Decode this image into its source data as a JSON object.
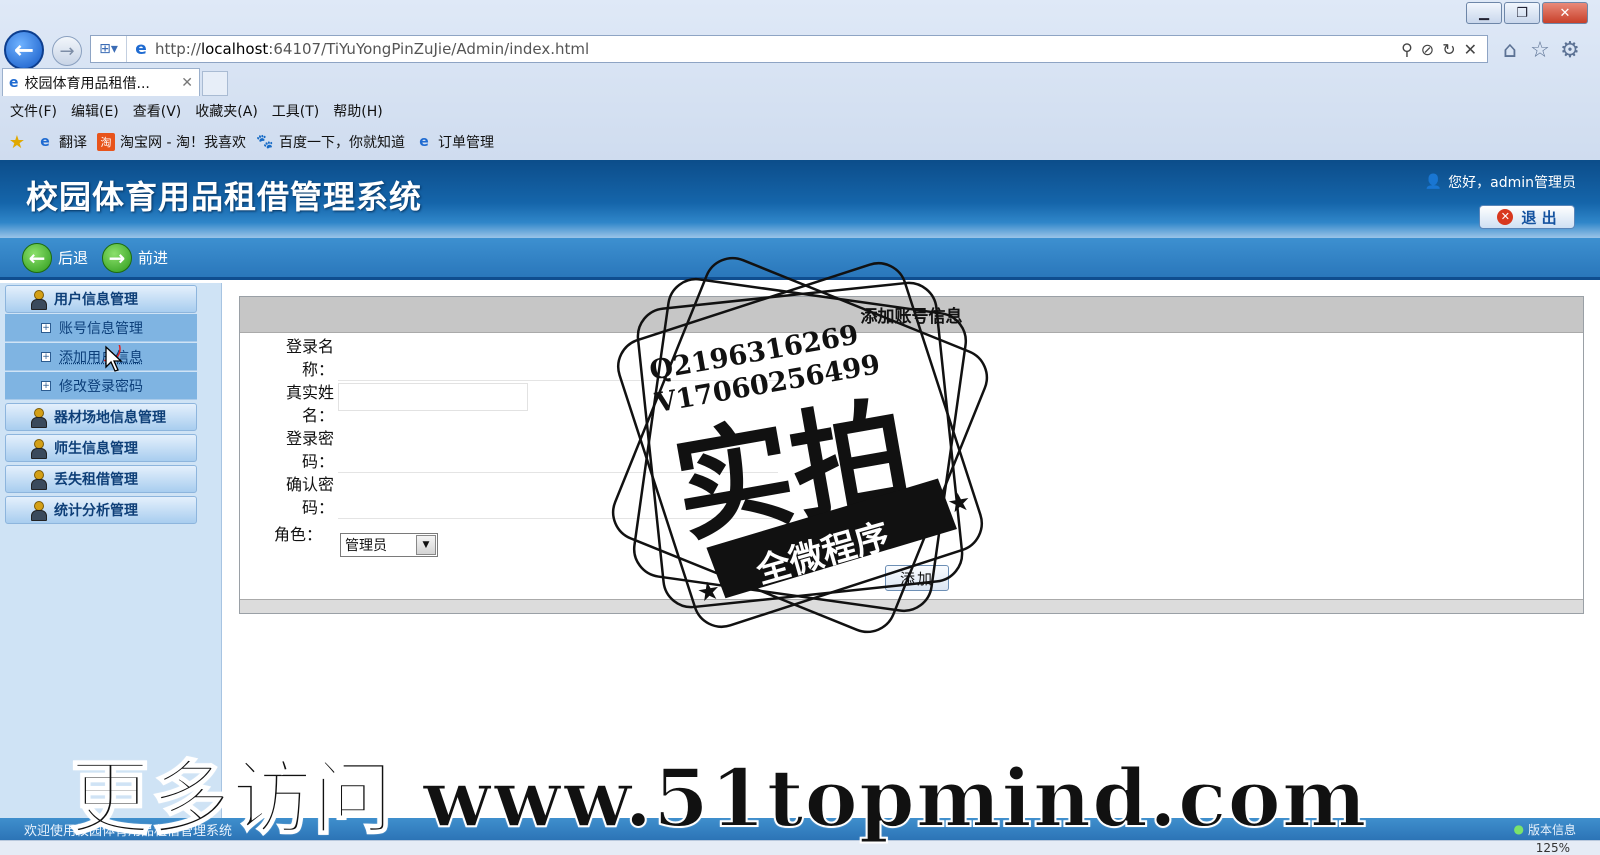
{
  "browser": {
    "url_prefix": "http://",
    "url_host": "localhost",
    "url_rest": ":64107/TiYuYongPinZuJie/Admin/index.html",
    "tab_title": "校园体育用品租借...",
    "menu": [
      "文件(F)",
      "编辑(E)",
      "查看(V)",
      "收藏夹(A)",
      "工具(T)",
      "帮助(H)"
    ],
    "favorites": [
      "翻译",
      "淘宝网 - 淘！我喜欢",
      "百度一下，你就知道",
      "订单管理"
    ],
    "zoom": "125%"
  },
  "app": {
    "title": "校园体育用品租借管理系统",
    "greeting": "您好，admin管理员",
    "logout_label": "退 出",
    "back_label": "后退",
    "forward_label": "前进",
    "status_text": "欢迎使用校园体育用品租借管理系统",
    "version_label": "版本信息"
  },
  "sidebar": {
    "groups": [
      {
        "label": "用户信息管理",
        "items": [
          "账号信息管理",
          "添加用户信息",
          "修改登录密码"
        ]
      },
      {
        "label": "器材场地信息管理"
      },
      {
        "label": "师生信息管理"
      },
      {
        "label": "丢失租借管理"
      },
      {
        "label": "统计分析管理"
      }
    ]
  },
  "form": {
    "title": "添加账号信息",
    "fields": [
      {
        "label": "登录名称：",
        "value": ""
      },
      {
        "label": "真实姓名：",
        "value": ""
      },
      {
        "label": "登录密码：",
        "value": ""
      },
      {
        "label": "确认密码：",
        "value": ""
      }
    ],
    "role_label": "角色：",
    "role_value": "管理员",
    "submit_label": "添加"
  },
  "watermark": {
    "line1": "Q2196316269",
    "line2": "V17060256499",
    "big": "实拍",
    "ribbon": "全微程序",
    "overlay": "更多访问 www.51topmind.com"
  },
  "colors": {
    "header_blue": "#1565aa",
    "sidebar_bg": "#cfe3f5",
    "submenu_blue": "#7fb4e2"
  }
}
